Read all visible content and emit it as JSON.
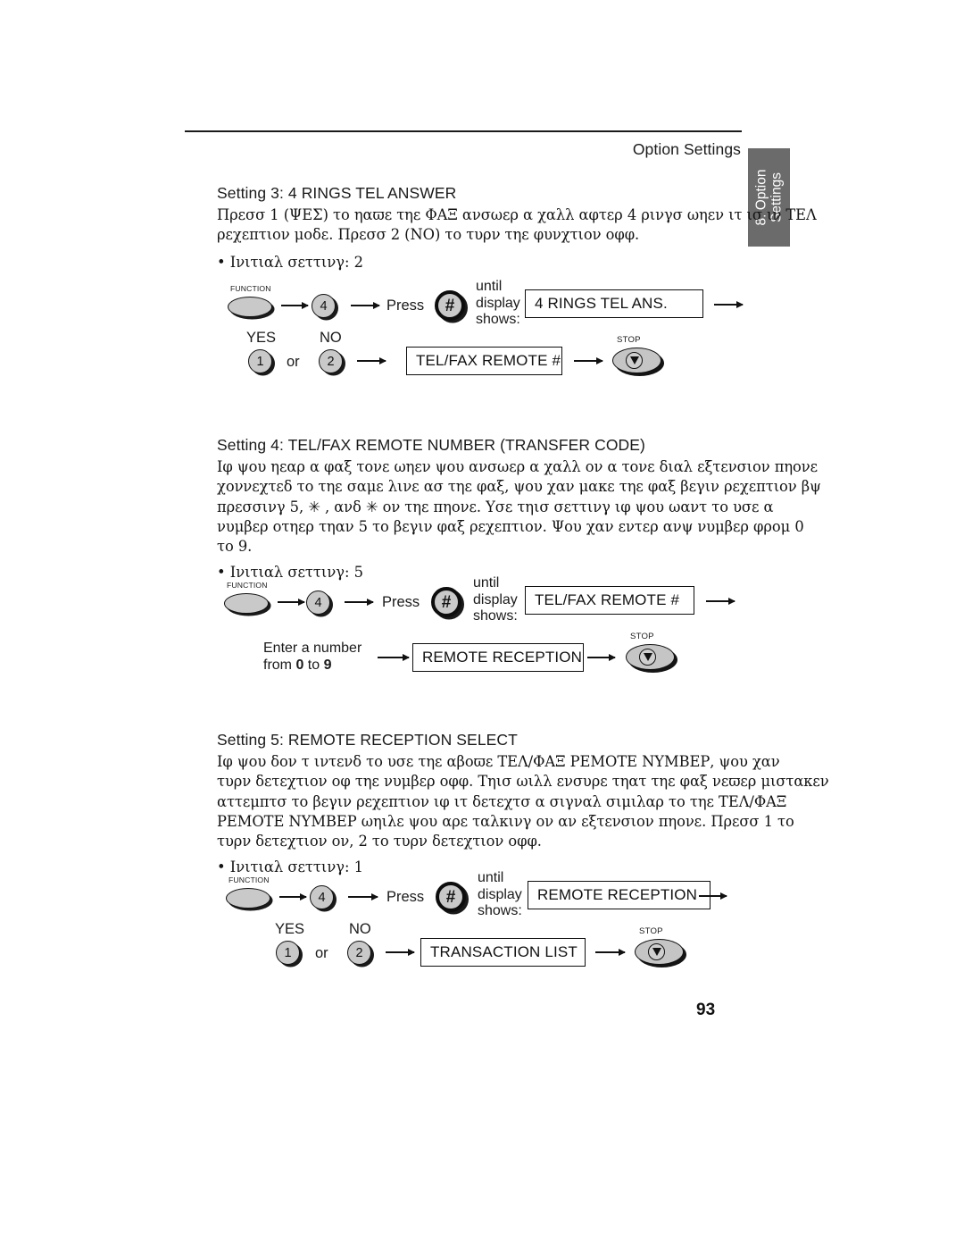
{
  "page": {
    "header_title": "Option Settings",
    "page_number": "93",
    "side_tab": {
      "line1": "8. Option",
      "line2": "Settings"
    }
  },
  "sections": [
    {
      "heading": "Setting 3: 4 RINGS TEL ANSWER",
      "body_lines": [
        "Πρεσσ 1 (ΨΕΣ) το ηαϖε τηε ΦΑΞ ανσωερ α χαλλ αφτερ 4 ρινγσ ωηεν ιτ ισ ιν ΤΕΛ",
        "ρεχεπτιον μοδε. Πρεσσ 2 (ΝΟ) το τυρν τηε φυνχτιον οφφ."
      ],
      "bullet": "• Ινιτιαλ σεττινγ: 2",
      "diagram": {
        "function_label": "FUNCTION",
        "key_4": "4",
        "press_label": "Press",
        "hash_key": "#",
        "until_display_shows": [
          "until",
          "display",
          "shows:"
        ],
        "display_1": "4 RINGS TEL ANS.",
        "yes_label": "YES",
        "no_label": "NO",
        "key_1": "1",
        "or_label": "or",
        "key_2": "2",
        "display_2": "TEL/FAX REMOTE #",
        "stop_label": "STOP"
      }
    },
    {
      "heading": "Setting 4: TEL/FAX REMOTE NUMBER (TRANSFER CODE)",
      "body_lines": [
        "Ιφ ψου ηεαρ α φαξ τονε ωηεν ψου ανσωερ α χαλλ ον α τονε διαλ εξτενσιον πηονε",
        "χοννεχτεδ το τηε σαμε λινε ασ τηε φαξ, ψου χαν μακε τηε φαξ βεγιν ρεχεπτιον βψ",
        "πρεσσινγ 5, ✳ , ανδ ✳  ον τηε πηονε. Υσε τηισ σεττινγ ιφ ψου ωαντ το υσε α",
        "νυμβερ οτηερ τηαν 5 το βεγιν φαξ ρεχεπτιον. Ψου χαν εντερ ανψ νυμβερ φρομ 0",
        "το 9."
      ],
      "bullet": "• Ινιτιαλ σεττινγ: 5",
      "diagram": {
        "function_label": "FUNCTION",
        "key_4": "4",
        "press_label": "Press",
        "hash_key": "#",
        "until_display_shows": [
          "until",
          "display",
          "shows:"
        ],
        "display_1": "TEL/FAX REMOTE #",
        "enter_line1": "Enter a number",
        "enter_line2_pre": "from ",
        "enter_line2_num1": "0",
        "enter_line2_mid": " to ",
        "enter_line2_num2": "9",
        "display_2": "REMOTE RECEPTION",
        "stop_label": "STOP"
      }
    },
    {
      "heading": "Setting 5: REMOTE RECEPTION SELECT",
      "body_lines": [
        "Ιφ ψου δον τ ιντενδ το υσε τηε αβοϖε ΤΕΛ/ΦΑΞ ΡΕΜΟΤΕ ΝΥΜΒΕΡ, ψου χαν",
        "τυρν δετεχτιον οφ τηε νυμβερ οφφ. Τηισ ωιλλ ενσυρε τηατ τηε φαξ νεϖερ μιστακεν",
        "αττεμπτσ το βεγιν ρεχεπτιον ιφ ιτ δετεχτσ α σιγναλ σιμιλαρ το τηε ΤΕΛ/ΦΑΞ",
        "ΡΕΜΟΤΕ ΝΥΜΒΕΡ ωηιλε ψου αρε ταλκινγ ον αν εξτενσιον πηονε. Πρεσσ 1 το",
        "τυρν δετεχτιον ον, 2 το τυρν δετεχτιον οφφ."
      ],
      "bullet": "• Ινιτιαλ σεττινγ: 1",
      "diagram": {
        "function_label": "FUNCTION",
        "key_4": "4",
        "press_label": "Press",
        "hash_key": "#",
        "until_display_shows": [
          "until",
          "display",
          "shows:"
        ],
        "display_1": "REMOTE RECEPTION",
        "yes_label": "YES",
        "no_label": "NO",
        "key_1": "1",
        "or_label": "or",
        "key_2": "2",
        "display_2": "TRANSACTION LIST",
        "stop_label": "STOP"
      }
    }
  ]
}
